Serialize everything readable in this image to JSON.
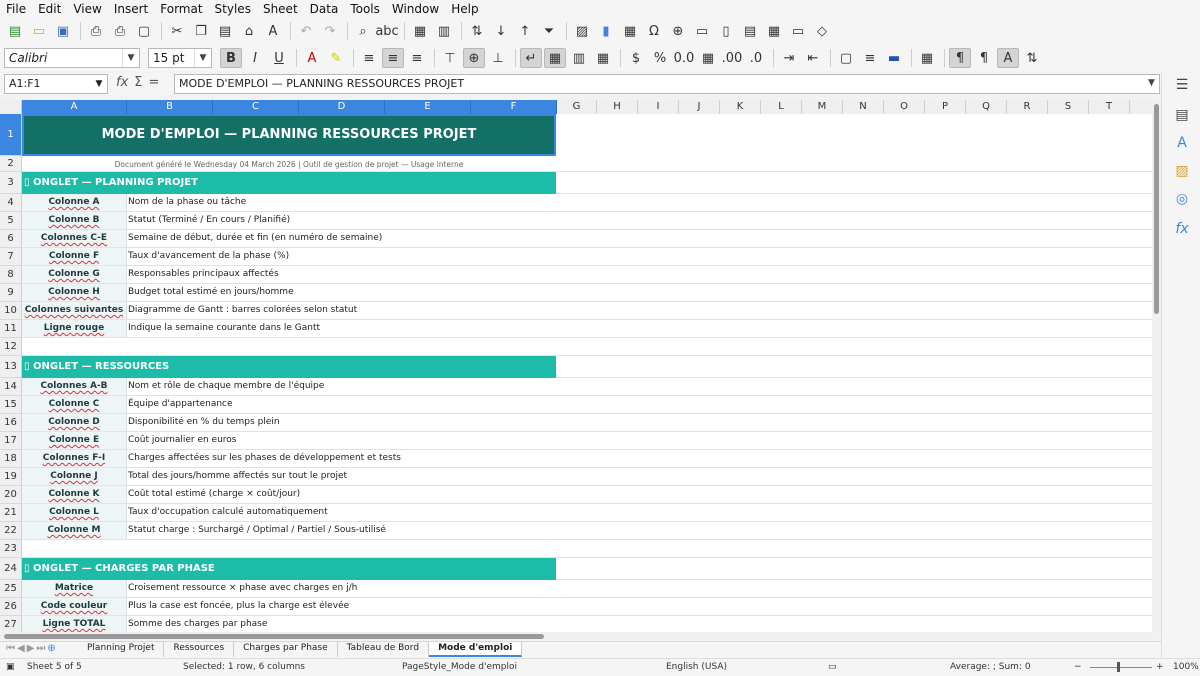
{
  "menu": [
    "File",
    "Edit",
    "View",
    "Insert",
    "Format",
    "Styles",
    "Sheet",
    "Data",
    "Tools",
    "Window",
    "Help"
  ],
  "toolbar": {
    "font_name": "Calibri",
    "font_size": "15 pt"
  },
  "formula_bar": {
    "name_box": "A1:F1",
    "content": "MODE D'EMPLOI — PLANNING RESSOURCES PROJET"
  },
  "columns": [
    "A",
    "B",
    "C",
    "D",
    "E",
    "F",
    "G",
    "H",
    "I",
    "J",
    "K",
    "L",
    "M",
    "N",
    "O",
    "P",
    "Q",
    "R",
    "S",
    "T"
  ],
  "sheet": {
    "title": "MODE D'EMPLOI — PLANNING RESSOURCES PROJET",
    "subtitle": "Document généré le Wednesday 04 March 2026  |  Outil de gestion de projet — Usage interne",
    "rows": [
      {
        "num": "3",
        "type": "section",
        "text": "▯ ONGLET — PLANNING PROJET"
      },
      {
        "num": "4",
        "type": "item",
        "key": "Colonne A",
        "desc": "Nom de la phase ou tâche"
      },
      {
        "num": "5",
        "type": "item",
        "key": "Colonne B",
        "desc": "Statut (Terminé / En cours / Planifié)"
      },
      {
        "num": "6",
        "type": "item",
        "key": "Colonnes C-E",
        "desc": "Semaine de début, durée et fin (en numéro de semaine)"
      },
      {
        "num": "7",
        "type": "item",
        "key": "Colonne F",
        "desc": "Taux d'avancement de la phase (%)"
      },
      {
        "num": "8",
        "type": "item",
        "key": "Colonne G",
        "desc": "Responsables principaux affectés"
      },
      {
        "num": "9",
        "type": "item",
        "key": "Colonne H",
        "desc": "Budget total estimé en jours/homme"
      },
      {
        "num": "10",
        "type": "item",
        "key": "Colonnes suivantes",
        "desc": "Diagramme de Gantt : barres colorées selon statut"
      },
      {
        "num": "11",
        "type": "item",
        "key": "Ligne rouge",
        "desc": "Indique la semaine courante dans le Gantt"
      },
      {
        "num": "12",
        "type": "blank"
      },
      {
        "num": "13",
        "type": "section",
        "text": "▯ ONGLET — RESSOURCES"
      },
      {
        "num": "14",
        "type": "item",
        "key": "Colonnes A-B",
        "desc": "Nom et rôle de chaque membre de l'équipe"
      },
      {
        "num": "15",
        "type": "item",
        "key": "Colonne C",
        "desc": "Équipe d'appartenance"
      },
      {
        "num": "16",
        "type": "item",
        "key": "Colonne D",
        "desc": "Disponibilité en % du temps plein"
      },
      {
        "num": "17",
        "type": "item",
        "key": "Colonne E",
        "desc": "Coût journalier en euros"
      },
      {
        "num": "18",
        "type": "item",
        "key": "Colonnes F-I",
        "desc": "Charges affectées sur les phases de développement et tests"
      },
      {
        "num": "19",
        "type": "item",
        "key": "Colonne J",
        "desc": "Total des jours/homme affectés sur tout le projet"
      },
      {
        "num": "20",
        "type": "item",
        "key": "Colonne K",
        "desc": "Coût total estimé (charge × coût/jour)"
      },
      {
        "num": "21",
        "type": "item",
        "key": "Colonne L",
        "desc": "Taux d'occupation calculé automatiquement"
      },
      {
        "num": "22",
        "type": "item",
        "key": "Colonne M",
        "desc": "Statut charge : Surchargé / Optimal / Partiel / Sous-utilisé"
      },
      {
        "num": "23",
        "type": "blank"
      },
      {
        "num": "24",
        "type": "section",
        "text": "▯ ONGLET — CHARGES PAR PHASE"
      },
      {
        "num": "25",
        "type": "item",
        "key": "Matrice",
        "desc": "Croisement ressource × phase avec charges en j/h"
      },
      {
        "num": "26",
        "type": "item",
        "key": "Code couleur",
        "desc": "Plus la case est foncée, plus la charge est élevée"
      },
      {
        "num": "27",
        "type": "item",
        "key": "Ligne TOTAL",
        "desc": "Somme des charges par phase"
      }
    ]
  },
  "tabs": [
    "Planning Projet",
    "Ressources",
    "Charges par Phase",
    "Tableau de Bord",
    "Mode d'emploi"
  ],
  "active_tab": "Mode d'emploi",
  "status": {
    "sheet": "Sheet 5 of 5",
    "selection": "Selected: 1 row, 6 columns",
    "page_style": "PageStyle_Mode d'emploi",
    "language": "English (USA)",
    "sum": "Average: ; Sum: 0",
    "zoom": "100%"
  },
  "colors": {
    "title_bg": "#127066",
    "section_bg": "#1cbca8",
    "key_bg": "#eef5f7",
    "selection": "#3b86e0"
  }
}
